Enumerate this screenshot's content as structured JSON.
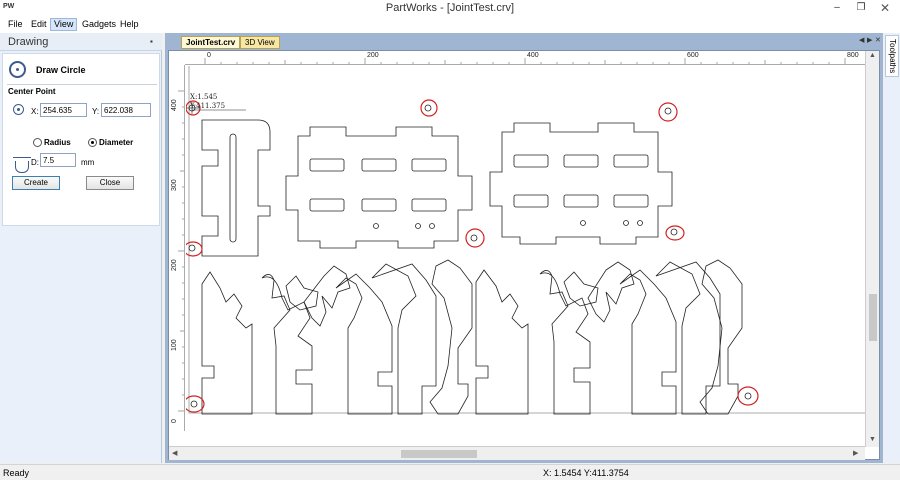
{
  "window": {
    "title": "PartWorks - [JointTest.crv]",
    "logo": "PW",
    "minimize": "‒",
    "maximize": "❐",
    "close": "✕"
  },
  "menu": [
    {
      "label": "File"
    },
    {
      "label": "Edit"
    },
    {
      "label": "View"
    },
    {
      "label": "Gadgets"
    },
    {
      "label": "Help"
    }
  ],
  "panel": {
    "title": "Drawing",
    "pin": "▪",
    "tool_name": "Draw Circle",
    "center_point_label": "Center Point",
    "x_label": "X:",
    "x_value": "254.635",
    "y_label": "Y:",
    "y_value": "622.038",
    "radius_label": "Radius",
    "diameter_label": "Diameter",
    "d_label": "D:",
    "d_value": "7.5",
    "unit": "mm",
    "create_label": "Create",
    "close_label": "Close"
  },
  "tabs": [
    {
      "label": "JointTest.crv"
    },
    {
      "label": "3D View"
    }
  ],
  "tab_arrows": {
    "left": "◀",
    "right": "▶",
    "close": "✕"
  },
  "ruler": {
    "h_labels": [
      "0",
      "200",
      "400",
      "600",
      "800"
    ],
    "v_labels": [
      "400",
      "300",
      "200",
      "100",
      "0"
    ]
  },
  "canvas": {
    "cursor_x": "X:1.545",
    "cursor_y": "Y:411.375"
  },
  "toolpaths_label": "Toolpaths",
  "status": {
    "ready": "Ready",
    "coords": "X:  1.5454 Y:411.3754"
  }
}
